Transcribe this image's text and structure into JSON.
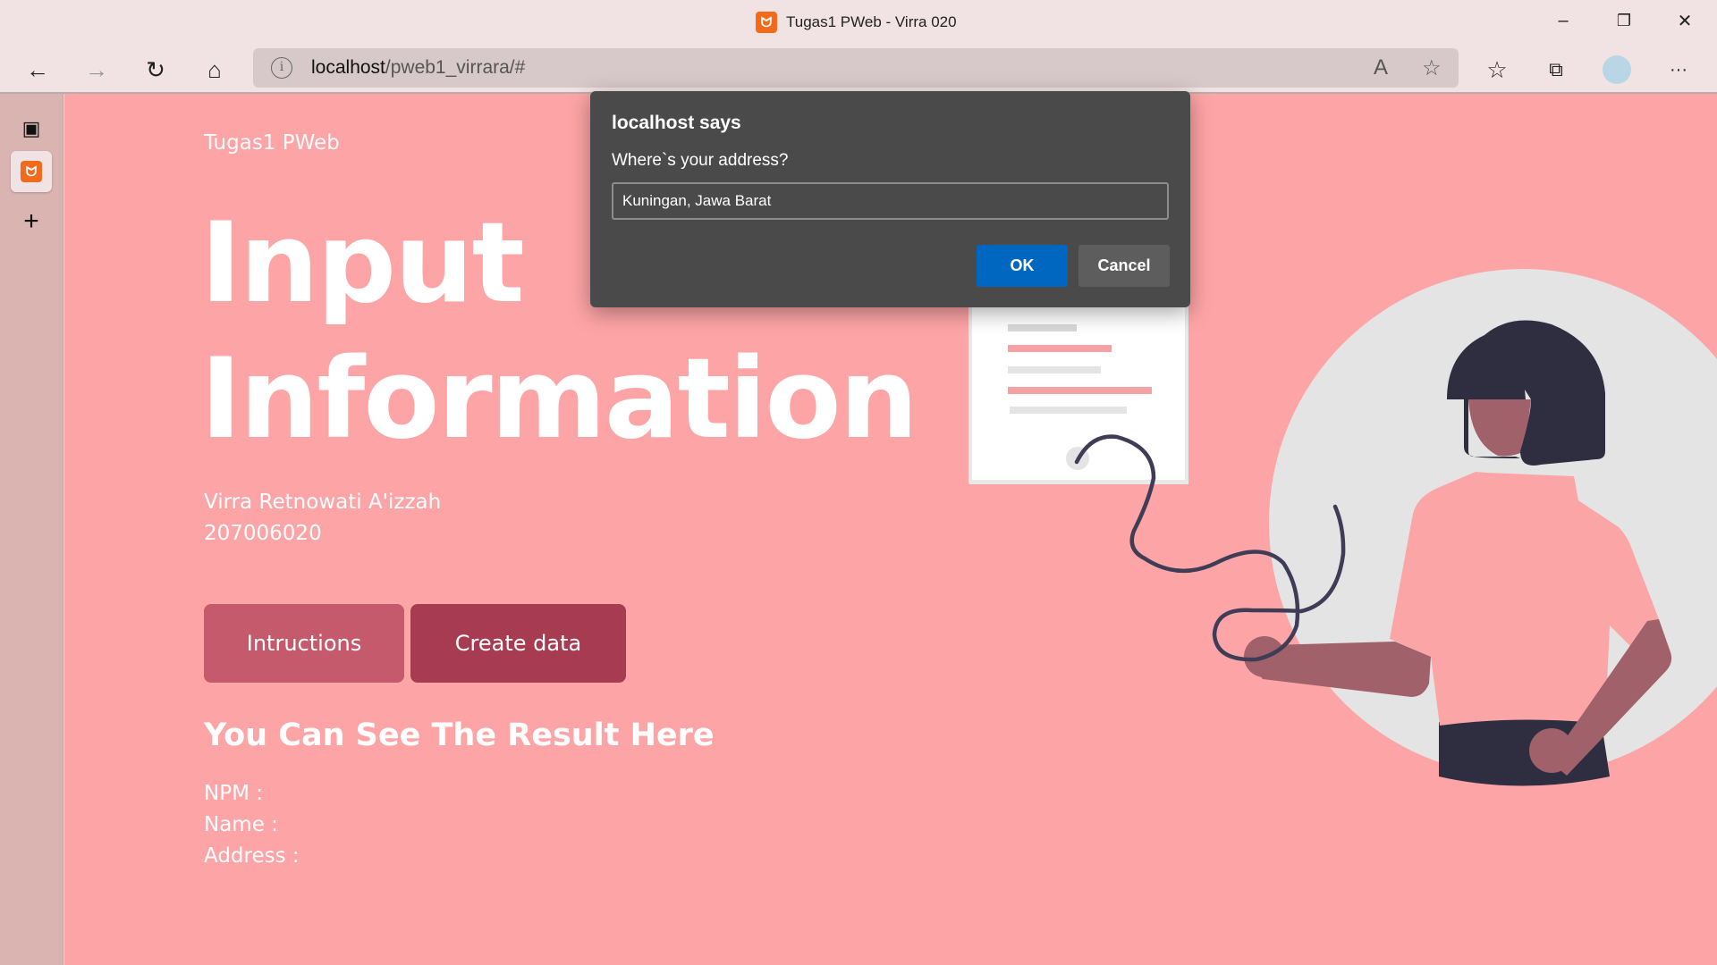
{
  "window": {
    "title": "Tugas1 PWeb - Virra 020",
    "app_icon": "xampp-icon"
  },
  "toolbar": {
    "url_host": "localhost",
    "url_path": "/pweb1_virrara/#"
  },
  "page": {
    "brand": "Tugas1 PWeb",
    "heading_line1": "Input",
    "heading_line2": "Information",
    "author_name": "Virra Retnowati A'izzah",
    "author_npm": "207006020",
    "buttons": {
      "instructions": "Intructions",
      "create": "Create data"
    },
    "result_title": "You Can See The Result Here",
    "result": {
      "npm": "NPM :",
      "name": "Name :",
      "address": "Address :"
    }
  },
  "dialog": {
    "title": "localhost says",
    "message": "Where`s your address?",
    "input_value": "Kuningan, Jawa Barat",
    "ok": "OK",
    "cancel": "Cancel"
  },
  "colors": {
    "page_bg": "#fda4a6",
    "btn_primary": "#c45a6c",
    "btn_secondary": "#a63b52",
    "dialog_ok": "#0067c0"
  }
}
